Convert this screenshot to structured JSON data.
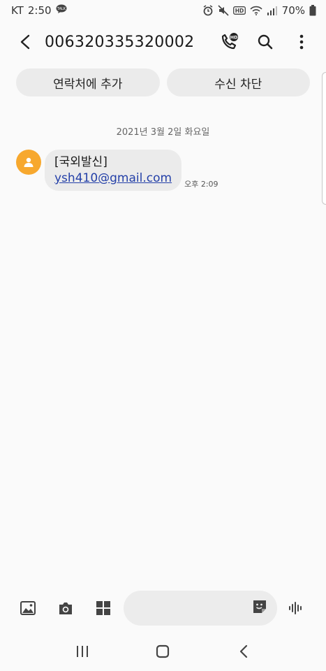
{
  "status_bar": {
    "carrier": "KT",
    "time": "2:50",
    "battery": "70%"
  },
  "header": {
    "title": "006320335320002",
    "hd_badge": "HD"
  },
  "actions": {
    "add_contact": "연락처에 추가",
    "block": "수신 차단"
  },
  "conversation": {
    "date": "2021년 3월 2일 화요일",
    "messages": [
      {
        "line1": "[국외발신]",
        "link": "ysh410@gmail.com",
        "time": "오후 2:09"
      }
    ]
  },
  "composer": {
    "placeholder": ""
  },
  "colors": {
    "avatar": "#f7a82e",
    "link": "#2440a8",
    "bubble": "#ebebeb"
  }
}
